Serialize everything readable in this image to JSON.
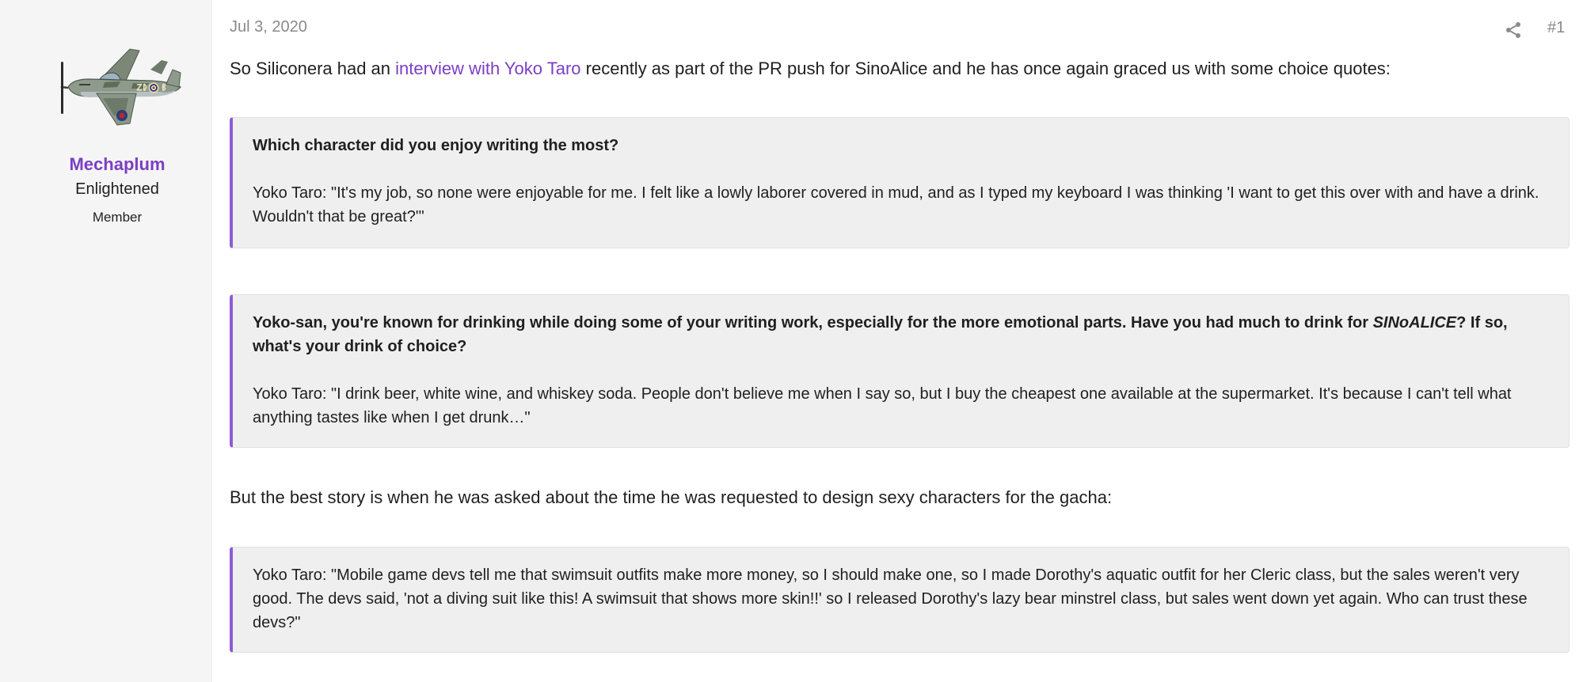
{
  "user": {
    "name": "Mechaplum",
    "title": "Enlightened",
    "role": "Member"
  },
  "post": {
    "date": "Jul 3, 2020",
    "number": "#1",
    "intro_before": "So Siliconera had an ",
    "intro_link": "interview with Yoko Taro",
    "intro_after": " recently as part of the PR push for SinoAlice and he has once again graced us with some choice quotes:",
    "quote1_question": "Which character did you enjoy writing the most?",
    "quote1_answer": "Yoko Taro: \"It's my job, so none were enjoyable for me. I felt like a lowly laborer covered in mud, and as I typed my keyboard I was thinking 'I want to get this over with and have a drink. Wouldn't that be great?'\"",
    "quote2_question_before": "Yoko-san, you're known for drinking while doing some of your writing work, especially for the more emotional parts. Have you had much to drink for ",
    "quote2_question_italic": "SINoALICE",
    "quote2_question_after": "? If so, what's your drink of choice?",
    "quote2_answer": "Yoko Taro: \"I drink beer, white wine, and whiskey soda. People don't believe me when I say so, but I buy the cheapest one available at the supermarket. It's because I can't tell what anything tastes like when I get drunk…\"",
    "middle_text": "But the best story is when he was asked about the time he was requested to design sexy characters for the gacha:",
    "quote3_answer": "Yoko Taro: \"Mobile game devs tell me that swimsuit outfits make more money, so I should make one, so I made Dorothy's aquatic outfit for her Cleric class, but the sales weren't very good. The devs said, 'not a diving suit like this! A swimsuit that shows more skin!!' so I released Dorothy's lazy bear minstrel class, but sales went down yet again. Who can trust these devs?\""
  },
  "icons": {
    "share": "share-icon",
    "avatar": "spitfire-airplane-avatar"
  },
  "colors": {
    "accent": "#7b3fc4",
    "quote_border": "#8e5bd4",
    "quote_bg": "#efefef",
    "sidebar_bg": "#f5f5f5",
    "muted": "#8a8a8a"
  }
}
